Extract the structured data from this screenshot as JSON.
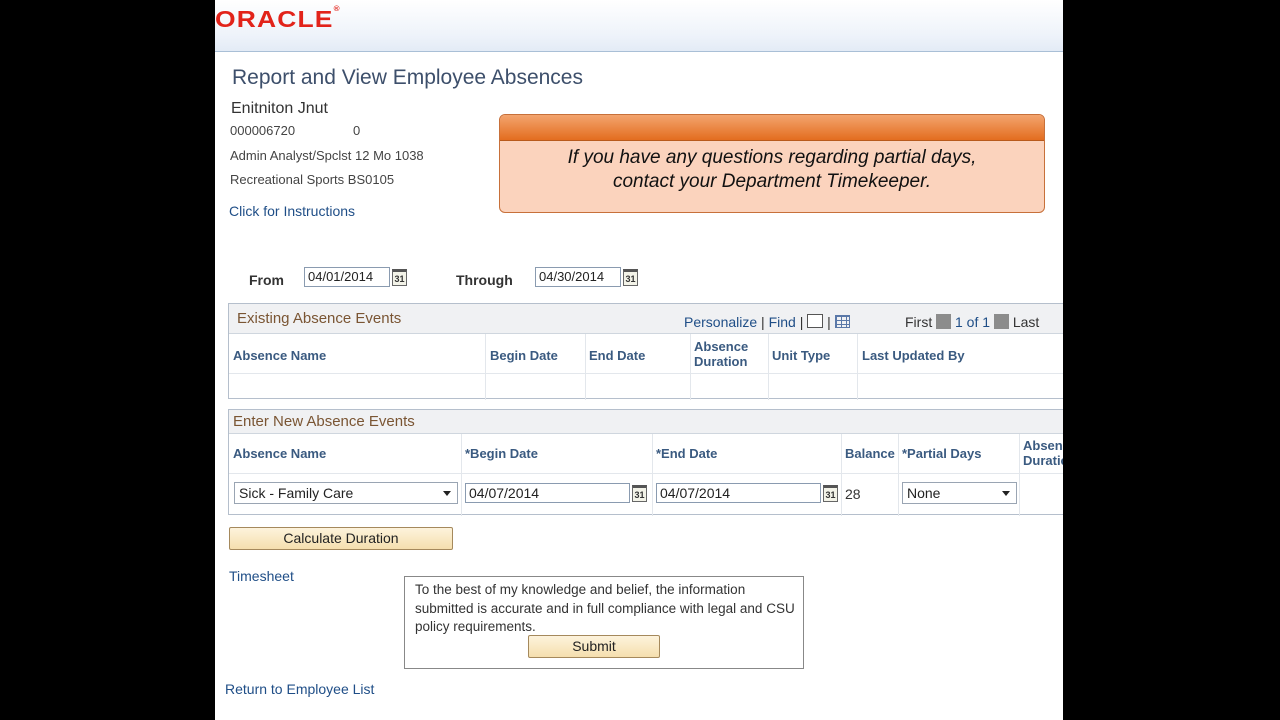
{
  "header": {
    "logo_text": "ORACLE"
  },
  "page": {
    "title": "Report and View Employee Absences",
    "employee_name": "Enitniton Jnut",
    "employee_id": "000006720",
    "employee_record": "0",
    "job_title": "Admin Analyst/Spclst 12 Mo  1038",
    "department": "Recreational Sports  BS0105",
    "instructions_link": "Click for Instructions"
  },
  "notice": {
    "line1": "If you have any questions regarding partial days,",
    "line2": "contact your Department Timekeeper."
  },
  "date_range": {
    "from_label": "From",
    "from_value": "04/01/2014",
    "through_label": "Through",
    "through_value": "04/30/2014"
  },
  "existing": {
    "title": "Existing Absence Events",
    "personalize": "Personalize",
    "find": "Find",
    "first": "First",
    "page_info": "1 of 1",
    "last": "Last",
    "columns": [
      "Absence Name",
      "Begin Date",
      "End Date",
      "Absence",
      "Duration",
      "Unit Type",
      "Last Updated By"
    ]
  },
  "new_events": {
    "title": "Enter New Absence Events",
    "columns": [
      "Absence Name",
      "*Begin Date",
      "*End Date",
      "Balance",
      "*Partial Days",
      "Absen",
      "Duratio"
    ],
    "row": {
      "absence_name": "Sick - Family Care",
      "begin_date": "04/07/2014",
      "end_date": "04/07/2014",
      "balance": "28",
      "partial_days": "None"
    }
  },
  "actions": {
    "calculate": "Calculate Duration",
    "timesheet": "Timesheet",
    "submit": "Submit",
    "return_link": "Return to Employee List"
  },
  "attestation": {
    "text": "To the best of my knowledge and belief, the information submitted is accurate and in full compliance with legal and CSU policy requirements."
  },
  "icons": {
    "calendar": "calendar-icon",
    "zoom": "view-all-icon",
    "grid": "download-grid-icon"
  },
  "colors": {
    "oracle_red": "#e2231a",
    "notice_orange": "#e36d1f",
    "link_blue": "#1f4e87"
  }
}
